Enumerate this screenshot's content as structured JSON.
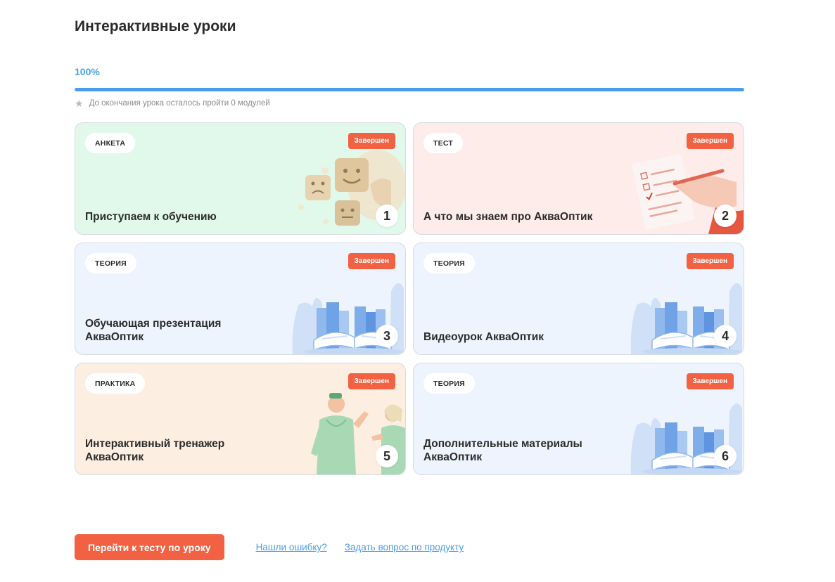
{
  "page": {
    "title": "Интерактивные уроки",
    "progress_label": "100%",
    "progress_fraction": 1.0,
    "remaining_text": "До окончания урока осталось пройти 0 модулей"
  },
  "colors": {
    "accent": "#4a9ded",
    "badge": "#f26242",
    "cta": "#f26242"
  },
  "modules": [
    {
      "tag": "АНКЕТА",
      "status": "Завершен",
      "title": "Приступаем к обучению",
      "number": "1",
      "theme": "green",
      "illustration": "emoji-faces-icon"
    },
    {
      "tag": "ТЕСТ",
      "status": "Завершен",
      "title": "А что мы знаем про АкваОптик",
      "number": "2",
      "theme": "pink",
      "illustration": "checklist-pen-icon"
    },
    {
      "tag": "ТЕОРИЯ",
      "status": "Завершен",
      "title": "Обучающая презентация АкваОптик",
      "number": "3",
      "theme": "blue",
      "illustration": "books-icon"
    },
    {
      "tag": "ТЕОРИЯ",
      "status": "Завершен",
      "title": "Видеоурок АкваОптик",
      "number": "4",
      "theme": "blue",
      "illustration": "books-icon"
    },
    {
      "tag": "ПРАКТИКА",
      "status": "Завершен",
      "title": "Интерактивный тренажер АкваОптик",
      "number": "5",
      "theme": "peach",
      "illustration": "people-talking-icon"
    },
    {
      "tag": "ТЕОРИЯ",
      "status": "Завершен",
      "title": "Дополнительные материалы АкваОптик",
      "number": "6",
      "theme": "blue",
      "illustration": "books-icon"
    }
  ],
  "actions": {
    "go_to_test": "Перейти к тесту по уроку",
    "report_error": "Нашли ошибку?",
    "ask_question": "Задать вопрос по продукту"
  }
}
